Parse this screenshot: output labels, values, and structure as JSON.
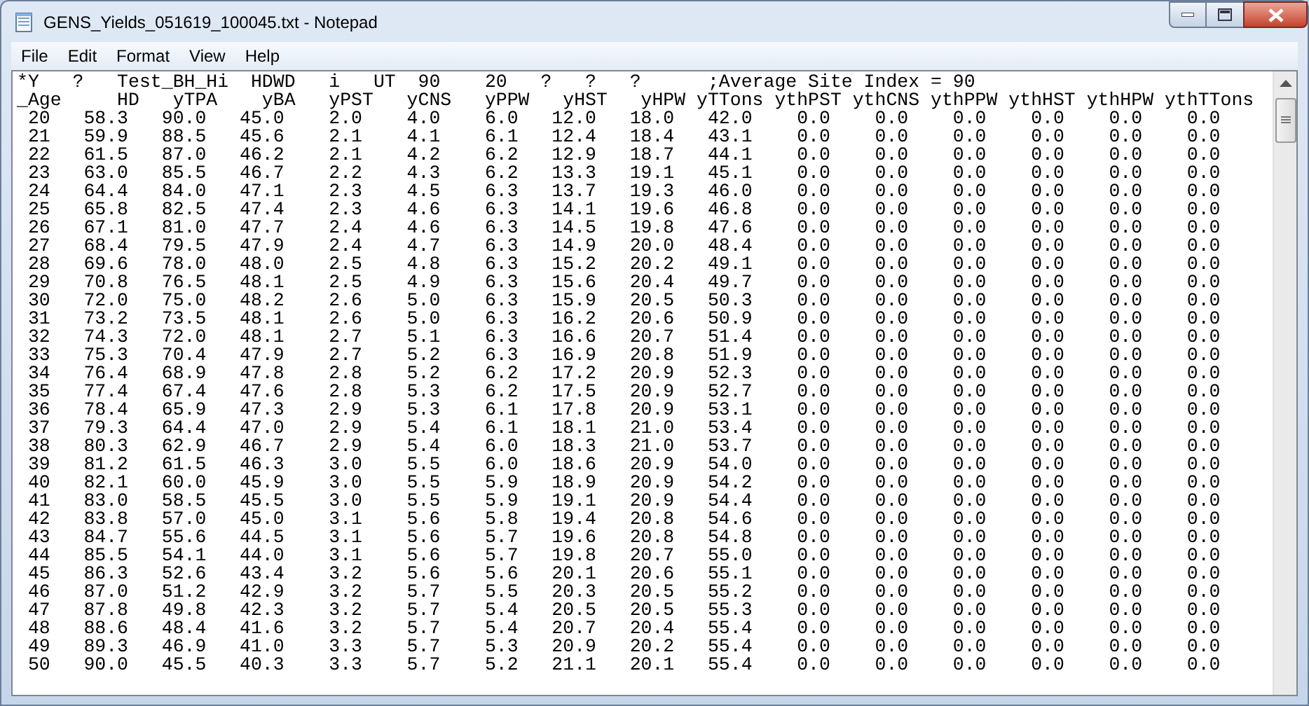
{
  "window": {
    "title": "GENS_Yields_051619_100045.txt - Notepad"
  },
  "menu": [
    "File",
    "Edit",
    "Format",
    "View",
    "Help"
  ],
  "document": {
    "first_line": "*Y   ?   Test_BH_Hi  HDWD   i   UT  90    20   ?   ?   ?      ;Average Site Index = 90",
    "columns": [
      "_Age",
      "HD",
      "yTPA",
      "yBA",
      "yPST",
      "yCNS",
      "yPPW",
      "yHST",
      "yHPW",
      "yTTons",
      "ythPST",
      "ythCNS",
      "ythPPW",
      "ythHST",
      "ythHPW",
      "ythTTons"
    ],
    "rows": [
      [
        "20",
        "58.3",
        "90.0",
        "45.0",
        "2.0",
        "4.0",
        "6.0",
        "12.0",
        "18.0",
        "42.0",
        "0.0",
        "0.0",
        "0.0",
        "0.0",
        "0.0",
        "0.0"
      ],
      [
        "21",
        "59.9",
        "88.5",
        "45.6",
        "2.1",
        "4.1",
        "6.1",
        "12.4",
        "18.4",
        "43.1",
        "0.0",
        "0.0",
        "0.0",
        "0.0",
        "0.0",
        "0.0"
      ],
      [
        "22",
        "61.5",
        "87.0",
        "46.2",
        "2.1",
        "4.2",
        "6.2",
        "12.9",
        "18.7",
        "44.1",
        "0.0",
        "0.0",
        "0.0",
        "0.0",
        "0.0",
        "0.0"
      ],
      [
        "23",
        "63.0",
        "85.5",
        "46.7",
        "2.2",
        "4.3",
        "6.2",
        "13.3",
        "19.1",
        "45.1",
        "0.0",
        "0.0",
        "0.0",
        "0.0",
        "0.0",
        "0.0"
      ],
      [
        "24",
        "64.4",
        "84.0",
        "47.1",
        "2.3",
        "4.5",
        "6.3",
        "13.7",
        "19.3",
        "46.0",
        "0.0",
        "0.0",
        "0.0",
        "0.0",
        "0.0",
        "0.0"
      ],
      [
        "25",
        "65.8",
        "82.5",
        "47.4",
        "2.3",
        "4.6",
        "6.3",
        "14.1",
        "19.6",
        "46.8",
        "0.0",
        "0.0",
        "0.0",
        "0.0",
        "0.0",
        "0.0"
      ],
      [
        "26",
        "67.1",
        "81.0",
        "47.7",
        "2.4",
        "4.6",
        "6.3",
        "14.5",
        "19.8",
        "47.6",
        "0.0",
        "0.0",
        "0.0",
        "0.0",
        "0.0",
        "0.0"
      ],
      [
        "27",
        "68.4",
        "79.5",
        "47.9",
        "2.4",
        "4.7",
        "6.3",
        "14.9",
        "20.0",
        "48.4",
        "0.0",
        "0.0",
        "0.0",
        "0.0",
        "0.0",
        "0.0"
      ],
      [
        "28",
        "69.6",
        "78.0",
        "48.0",
        "2.5",
        "4.8",
        "6.3",
        "15.2",
        "20.2",
        "49.1",
        "0.0",
        "0.0",
        "0.0",
        "0.0",
        "0.0",
        "0.0"
      ],
      [
        "29",
        "70.8",
        "76.5",
        "48.1",
        "2.5",
        "4.9",
        "6.3",
        "15.6",
        "20.4",
        "49.7",
        "0.0",
        "0.0",
        "0.0",
        "0.0",
        "0.0",
        "0.0"
      ],
      [
        "30",
        "72.0",
        "75.0",
        "48.2",
        "2.6",
        "5.0",
        "6.3",
        "15.9",
        "20.5",
        "50.3",
        "0.0",
        "0.0",
        "0.0",
        "0.0",
        "0.0",
        "0.0"
      ],
      [
        "31",
        "73.2",
        "73.5",
        "48.1",
        "2.6",
        "5.0",
        "6.3",
        "16.2",
        "20.6",
        "50.9",
        "0.0",
        "0.0",
        "0.0",
        "0.0",
        "0.0",
        "0.0"
      ],
      [
        "32",
        "74.3",
        "72.0",
        "48.1",
        "2.7",
        "5.1",
        "6.3",
        "16.6",
        "20.7",
        "51.4",
        "0.0",
        "0.0",
        "0.0",
        "0.0",
        "0.0",
        "0.0"
      ],
      [
        "33",
        "75.3",
        "70.4",
        "47.9",
        "2.7",
        "5.2",
        "6.3",
        "16.9",
        "20.8",
        "51.9",
        "0.0",
        "0.0",
        "0.0",
        "0.0",
        "0.0",
        "0.0"
      ],
      [
        "34",
        "76.4",
        "68.9",
        "47.8",
        "2.8",
        "5.2",
        "6.2",
        "17.2",
        "20.9",
        "52.3",
        "0.0",
        "0.0",
        "0.0",
        "0.0",
        "0.0",
        "0.0"
      ],
      [
        "35",
        "77.4",
        "67.4",
        "47.6",
        "2.8",
        "5.3",
        "6.2",
        "17.5",
        "20.9",
        "52.7",
        "0.0",
        "0.0",
        "0.0",
        "0.0",
        "0.0",
        "0.0"
      ],
      [
        "36",
        "78.4",
        "65.9",
        "47.3",
        "2.9",
        "5.3",
        "6.1",
        "17.8",
        "20.9",
        "53.1",
        "0.0",
        "0.0",
        "0.0",
        "0.0",
        "0.0",
        "0.0"
      ],
      [
        "37",
        "79.3",
        "64.4",
        "47.0",
        "2.9",
        "5.4",
        "6.1",
        "18.1",
        "21.0",
        "53.4",
        "0.0",
        "0.0",
        "0.0",
        "0.0",
        "0.0",
        "0.0"
      ],
      [
        "38",
        "80.3",
        "62.9",
        "46.7",
        "2.9",
        "5.4",
        "6.0",
        "18.3",
        "21.0",
        "53.7",
        "0.0",
        "0.0",
        "0.0",
        "0.0",
        "0.0",
        "0.0"
      ],
      [
        "39",
        "81.2",
        "61.5",
        "46.3",
        "3.0",
        "5.5",
        "6.0",
        "18.6",
        "20.9",
        "54.0",
        "0.0",
        "0.0",
        "0.0",
        "0.0",
        "0.0",
        "0.0"
      ],
      [
        "40",
        "82.1",
        "60.0",
        "45.9",
        "3.0",
        "5.5",
        "5.9",
        "18.9",
        "20.9",
        "54.2",
        "0.0",
        "0.0",
        "0.0",
        "0.0",
        "0.0",
        "0.0"
      ],
      [
        "41",
        "83.0",
        "58.5",
        "45.5",
        "3.0",
        "5.5",
        "5.9",
        "19.1",
        "20.9",
        "54.4",
        "0.0",
        "0.0",
        "0.0",
        "0.0",
        "0.0",
        "0.0"
      ],
      [
        "42",
        "83.8",
        "57.0",
        "45.0",
        "3.1",
        "5.6",
        "5.8",
        "19.4",
        "20.8",
        "54.6",
        "0.0",
        "0.0",
        "0.0",
        "0.0",
        "0.0",
        "0.0"
      ],
      [
        "43",
        "84.7",
        "55.6",
        "44.5",
        "3.1",
        "5.6",
        "5.7",
        "19.6",
        "20.8",
        "54.8",
        "0.0",
        "0.0",
        "0.0",
        "0.0",
        "0.0",
        "0.0"
      ],
      [
        "44",
        "85.5",
        "54.1",
        "44.0",
        "3.1",
        "5.6",
        "5.7",
        "19.8",
        "20.7",
        "55.0",
        "0.0",
        "0.0",
        "0.0",
        "0.0",
        "0.0",
        "0.0"
      ],
      [
        "45",
        "86.3",
        "52.6",
        "43.4",
        "3.2",
        "5.6",
        "5.6",
        "20.1",
        "20.6",
        "55.1",
        "0.0",
        "0.0",
        "0.0",
        "0.0",
        "0.0",
        "0.0"
      ],
      [
        "46",
        "87.0",
        "51.2",
        "42.9",
        "3.2",
        "5.7",
        "5.5",
        "20.3",
        "20.5",
        "55.2",
        "0.0",
        "0.0",
        "0.0",
        "0.0",
        "0.0",
        "0.0"
      ],
      [
        "47",
        "87.8",
        "49.8",
        "42.3",
        "3.2",
        "5.7",
        "5.4",
        "20.5",
        "20.5",
        "55.3",
        "0.0",
        "0.0",
        "0.0",
        "0.0",
        "0.0",
        "0.0"
      ],
      [
        "48",
        "88.6",
        "48.4",
        "41.6",
        "3.2",
        "5.7",
        "5.4",
        "20.7",
        "20.4",
        "55.4",
        "0.0",
        "0.0",
        "0.0",
        "0.0",
        "0.0",
        "0.0"
      ],
      [
        "49",
        "89.3",
        "46.9",
        "41.0",
        "3.3",
        "5.7",
        "5.3",
        "20.9",
        "20.2",
        "55.4",
        "0.0",
        "0.0",
        "0.0",
        "0.0",
        "0.0",
        "0.0"
      ],
      [
        "50",
        "90.0",
        "45.5",
        "40.3",
        "3.3",
        "5.7",
        "5.2",
        "21.1",
        "20.1",
        "55.4",
        "0.0",
        "0.0",
        "0.0",
        "0.0",
        "0.0",
        "0.0"
      ]
    ]
  }
}
